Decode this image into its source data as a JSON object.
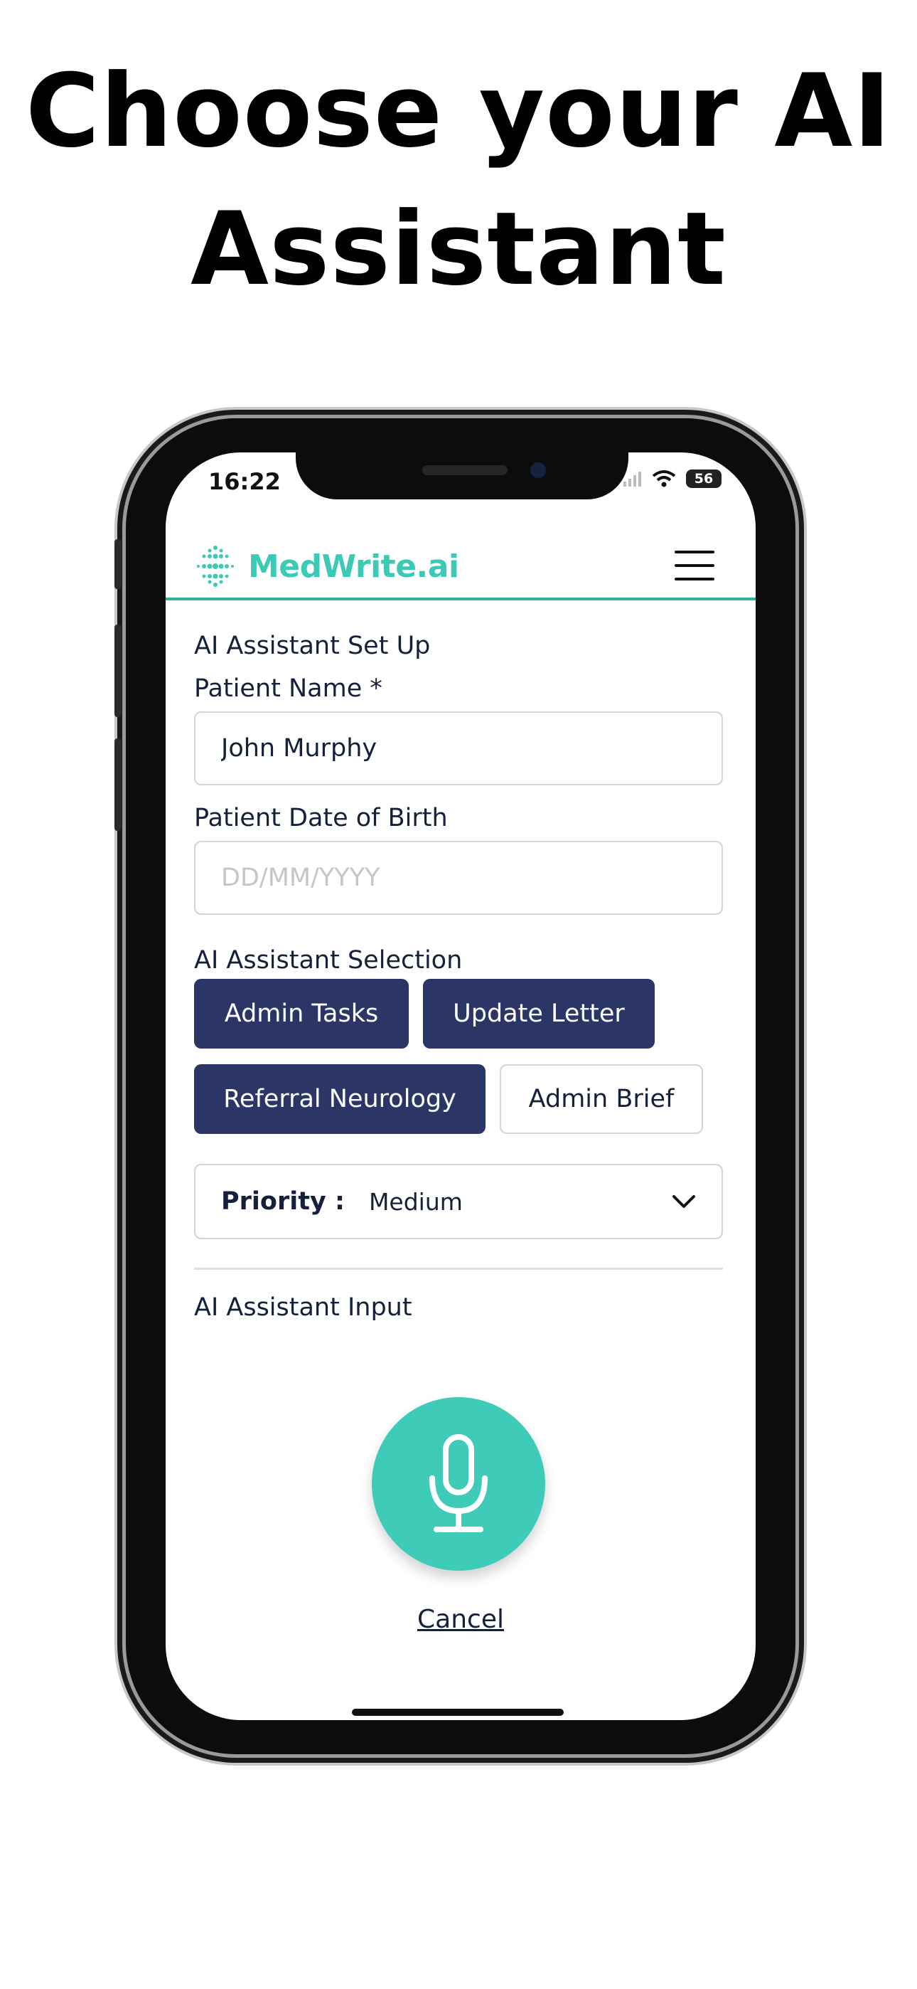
{
  "headline": {
    "line1": "Choose your AI",
    "line2": "Assistant"
  },
  "status_bar": {
    "time": "16:22",
    "battery": "56"
  },
  "header": {
    "brand": "MedWrite.ai",
    "brand_color": "#3ccab7",
    "menu_icon": "hamburger-menu-icon"
  },
  "form": {
    "section_title": "AI Assistant Set Up",
    "patient_name_label": "Patient Name *",
    "patient_name_value": "John Murphy",
    "dob_label": "Patient Date of Birth",
    "dob_placeholder": "DD/MM/YYYY"
  },
  "selection": {
    "title": "AI Assistant Selection",
    "options": [
      {
        "label": "Admin Tasks",
        "selected": true
      },
      {
        "label": "Update Letter",
        "selected": true
      },
      {
        "label": "Referral Neurology",
        "selected": true
      },
      {
        "label": "Admin Brief",
        "selected": false
      }
    ],
    "selected_color": "#2b3566"
  },
  "priority": {
    "label": "Priority :",
    "value": "Medium"
  },
  "input": {
    "title": "AI Assistant Input",
    "mic_icon": "microphone-icon",
    "mic_color": "#3ecbb7",
    "cancel_label": "Cancel"
  }
}
